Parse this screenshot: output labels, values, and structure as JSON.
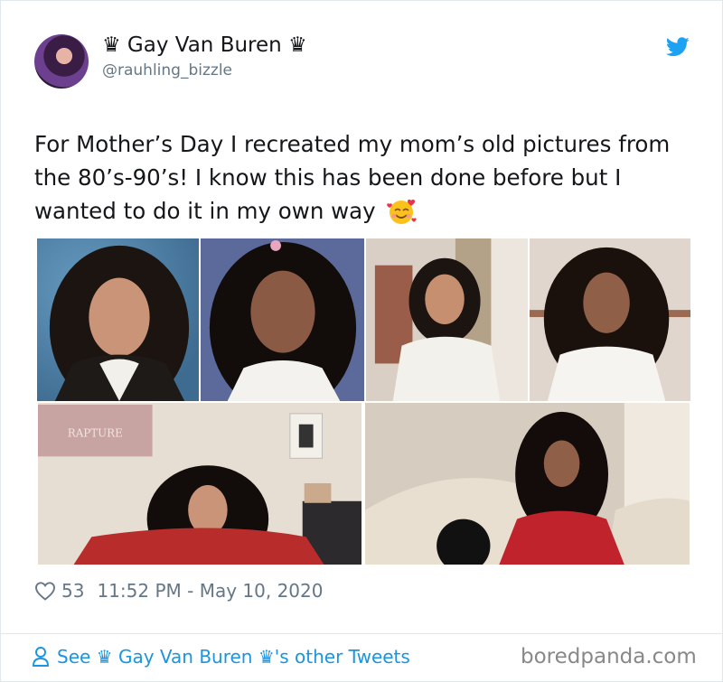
{
  "user": {
    "display_name": "♛ Gay Van Buren ♛",
    "handle": "@rauhling_bizzle"
  },
  "tweet": {
    "text": "For Mother’s Day I recreated my mom’s old pictures from the 80’s-90’s! I know this has been done before but I wanted to do it in my own way"
  },
  "stats": {
    "likes": "53",
    "timestamp": "11:52 PM - May 10, 2020"
  },
  "footer": {
    "see_tweets": "See ♛ Gay Van Buren ♛'s other Tweets",
    "watermark": "boredpanda.com"
  },
  "photos": [
    {
      "poster_text": ""
    },
    {
      "poster_text": ""
    },
    {
      "poster_text": ""
    },
    {
      "poster_text": ""
    },
    {
      "poster_text": "RAPTURE"
    },
    {
      "poster_text": ""
    }
  ],
  "colors": {
    "link": "#1b95e0",
    "text": "#14171a",
    "muted": "#657786",
    "twitter_blue": "#1da1f2"
  },
  "icons": [
    "twitter-bird-icon",
    "heart-icon",
    "person-icon",
    "smiling-face-with-hearts-icon"
  ]
}
